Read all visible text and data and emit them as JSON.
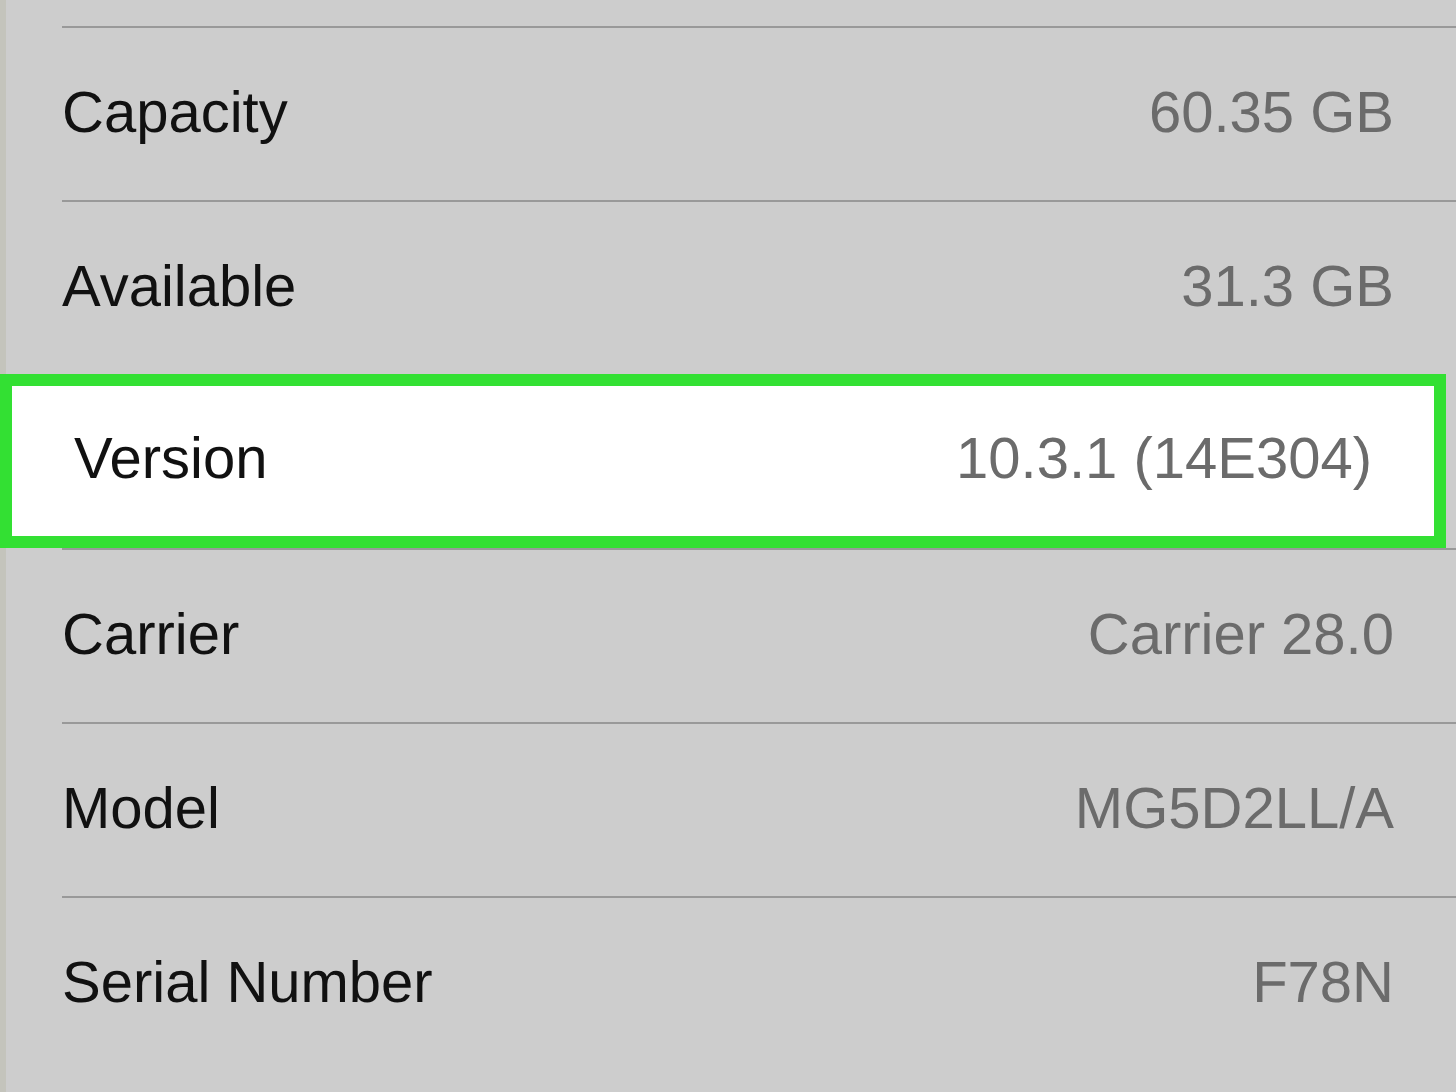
{
  "rows": [
    {
      "label": "Capacity",
      "value": "60.35 GB",
      "highlighted": false
    },
    {
      "label": "Available",
      "value": "31.3 GB",
      "highlighted": false
    },
    {
      "label": "Version",
      "value": "10.3.1 (14E304)",
      "highlighted": true
    },
    {
      "label": "Carrier",
      "value": "Carrier 28.0",
      "highlighted": false
    },
    {
      "label": "Model",
      "value": "MG5D2LL/A",
      "highlighted": false
    },
    {
      "label": "Serial Number",
      "value": "F78N",
      "highlighted": false
    }
  ]
}
